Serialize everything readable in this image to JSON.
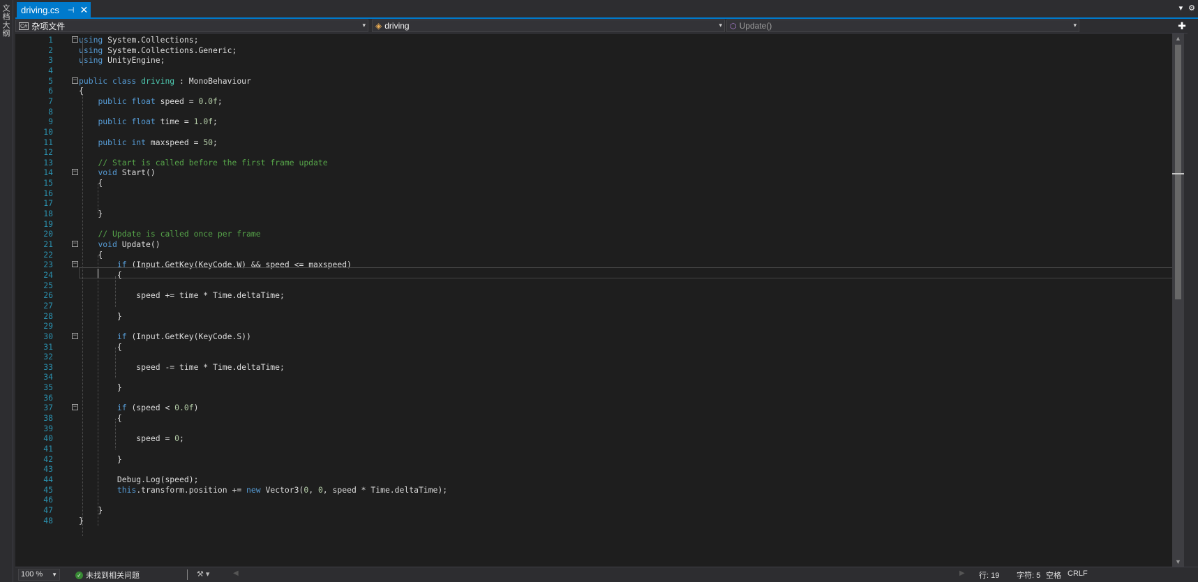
{
  "sidebar": {
    "vertical_tab": "文档大纲"
  },
  "tab": {
    "title": "driving.cs",
    "pin_icon": "pin-icon",
    "close_icon": "close-icon"
  },
  "navbar": {
    "project": "杂项文件",
    "class": "driving",
    "member": "Update()"
  },
  "code_lines": [
    {
      "n": "1",
      "fold": true,
      "parts": [
        [
          "kw",
          "using"
        ],
        [
          "pl",
          " System.Collections;"
        ]
      ]
    },
    {
      "n": "2",
      "parts": [
        [
          "kw",
          "using"
        ],
        [
          "pl",
          " System.Collections.Generic;"
        ]
      ]
    },
    {
      "n": "3",
      "parts": [
        [
          "kw",
          "using"
        ],
        [
          "pl",
          " UnityEngine;"
        ]
      ]
    },
    {
      "n": "4",
      "parts": []
    },
    {
      "n": "5",
      "fold": true,
      "parts": [
        [
          "kw",
          "public class "
        ],
        [
          "ty",
          "driving"
        ],
        [
          "pl",
          " : "
        ],
        [
          "pl",
          "MonoBehaviour"
        ]
      ]
    },
    {
      "n": "6",
      "parts": [
        [
          "pl",
          "{"
        ]
      ]
    },
    {
      "n": "7",
      "parts": [
        [
          "pl",
          "    "
        ],
        [
          "kw",
          "public float"
        ],
        [
          "pl",
          " speed = "
        ],
        [
          "nm",
          "0.0f"
        ],
        [
          "pl",
          ";"
        ]
      ]
    },
    {
      "n": "8",
      "parts": []
    },
    {
      "n": "9",
      "parts": [
        [
          "pl",
          "    "
        ],
        [
          "kw",
          "public float"
        ],
        [
          "pl",
          " time = "
        ],
        [
          "nm",
          "1.0f"
        ],
        [
          "pl",
          ";"
        ]
      ]
    },
    {
      "n": "10",
      "parts": []
    },
    {
      "n": "11",
      "parts": [
        [
          "pl",
          "    "
        ],
        [
          "kw",
          "public int"
        ],
        [
          "pl",
          " maxspeed = "
        ],
        [
          "nm",
          "50"
        ],
        [
          "pl",
          ";"
        ]
      ]
    },
    {
      "n": "12",
      "parts": []
    },
    {
      "n": "13",
      "parts": [
        [
          "pl",
          "    "
        ],
        [
          "cm",
          "// Start is called before the first frame update"
        ]
      ]
    },
    {
      "n": "14",
      "fold": true,
      "parts": [
        [
          "pl",
          "    "
        ],
        [
          "kw",
          "void"
        ],
        [
          "pl",
          " Start()"
        ]
      ]
    },
    {
      "n": "15",
      "parts": [
        [
          "pl",
          "    {"
        ]
      ]
    },
    {
      "n": "16",
      "parts": []
    },
    {
      "n": "17",
      "parts": []
    },
    {
      "n": "18",
      "parts": [
        [
          "pl",
          "    }"
        ]
      ]
    },
    {
      "n": "19",
      "parts": []
    },
    {
      "n": "20",
      "parts": [
        [
          "pl",
          "    "
        ],
        [
          "cm",
          "// Update is called once per frame"
        ]
      ]
    },
    {
      "n": "21",
      "fold": true,
      "parts": [
        [
          "pl",
          "    "
        ],
        [
          "kw",
          "void"
        ],
        [
          "pl",
          " Update()"
        ]
      ]
    },
    {
      "n": "22",
      "parts": [
        [
          "pl",
          "    {"
        ]
      ]
    },
    {
      "n": "23",
      "fold": true,
      "parts": [
        [
          "pl",
          "        "
        ],
        [
          "kw",
          "if"
        ],
        [
          "pl",
          " (Input.GetKey(KeyCode.W) && speed <= maxspeed)"
        ]
      ]
    },
    {
      "n": "24",
      "parts": [
        [
          "pl",
          "        {"
        ]
      ]
    },
    {
      "n": "25",
      "parts": []
    },
    {
      "n": "26",
      "parts": [
        [
          "pl",
          "            speed += time * Time.deltaTime;"
        ]
      ]
    },
    {
      "n": "27",
      "parts": []
    },
    {
      "n": "28",
      "parts": [
        [
          "pl",
          "        }"
        ]
      ]
    },
    {
      "n": "29",
      "parts": []
    },
    {
      "n": "30",
      "fold": true,
      "parts": [
        [
          "pl",
          "        "
        ],
        [
          "kw",
          "if"
        ],
        [
          "pl",
          " (Input.GetKey(KeyCode.S))"
        ]
      ]
    },
    {
      "n": "31",
      "parts": [
        [
          "pl",
          "        {"
        ]
      ]
    },
    {
      "n": "32",
      "parts": []
    },
    {
      "n": "33",
      "parts": [
        [
          "pl",
          "            speed -= time * Time.deltaTime;"
        ]
      ]
    },
    {
      "n": "34",
      "parts": []
    },
    {
      "n": "35",
      "parts": [
        [
          "pl",
          "        }"
        ]
      ]
    },
    {
      "n": "36",
      "parts": []
    },
    {
      "n": "37",
      "fold": true,
      "parts": [
        [
          "pl",
          "        "
        ],
        [
          "kw",
          "if"
        ],
        [
          "pl",
          " (speed < "
        ],
        [
          "nm",
          "0.0f"
        ],
        [
          "pl",
          ")"
        ]
      ]
    },
    {
      "n": "38",
      "parts": [
        [
          "pl",
          "        {"
        ]
      ]
    },
    {
      "n": "39",
      "parts": []
    },
    {
      "n": "40",
      "parts": [
        [
          "pl",
          "            speed = "
        ],
        [
          "nm",
          "0"
        ],
        [
          "pl",
          ";"
        ]
      ]
    },
    {
      "n": "41",
      "parts": []
    },
    {
      "n": "42",
      "parts": [
        [
          "pl",
          "        }"
        ]
      ]
    },
    {
      "n": "43",
      "parts": []
    },
    {
      "n": "44",
      "parts": [
        [
          "pl",
          "        Debug.Log(speed);"
        ]
      ]
    },
    {
      "n": "45",
      "parts": [
        [
          "pl",
          "        "
        ],
        [
          "kw",
          "this"
        ],
        [
          "pl",
          ".transform.position += "
        ],
        [
          "kw",
          "new"
        ],
        [
          "pl",
          " Vector3("
        ],
        [
          "nm",
          "0"
        ],
        [
          "pl",
          ", "
        ],
        [
          "nm",
          "0"
        ],
        [
          "pl",
          ", speed * Time.deltaTime);"
        ]
      ]
    },
    {
      "n": "46",
      "parts": []
    },
    {
      "n": "47",
      "parts": [
        [
          "pl",
          "    }"
        ]
      ]
    },
    {
      "n": "48",
      "parts": [
        [
          "pl",
          "}"
        ]
      ]
    }
  ],
  "status": {
    "zoom": "100 %",
    "issues": "未找到相关问题",
    "line": "行: 19",
    "char": "字符: 5",
    "indent": "空格",
    "eol": "CRLF"
  }
}
